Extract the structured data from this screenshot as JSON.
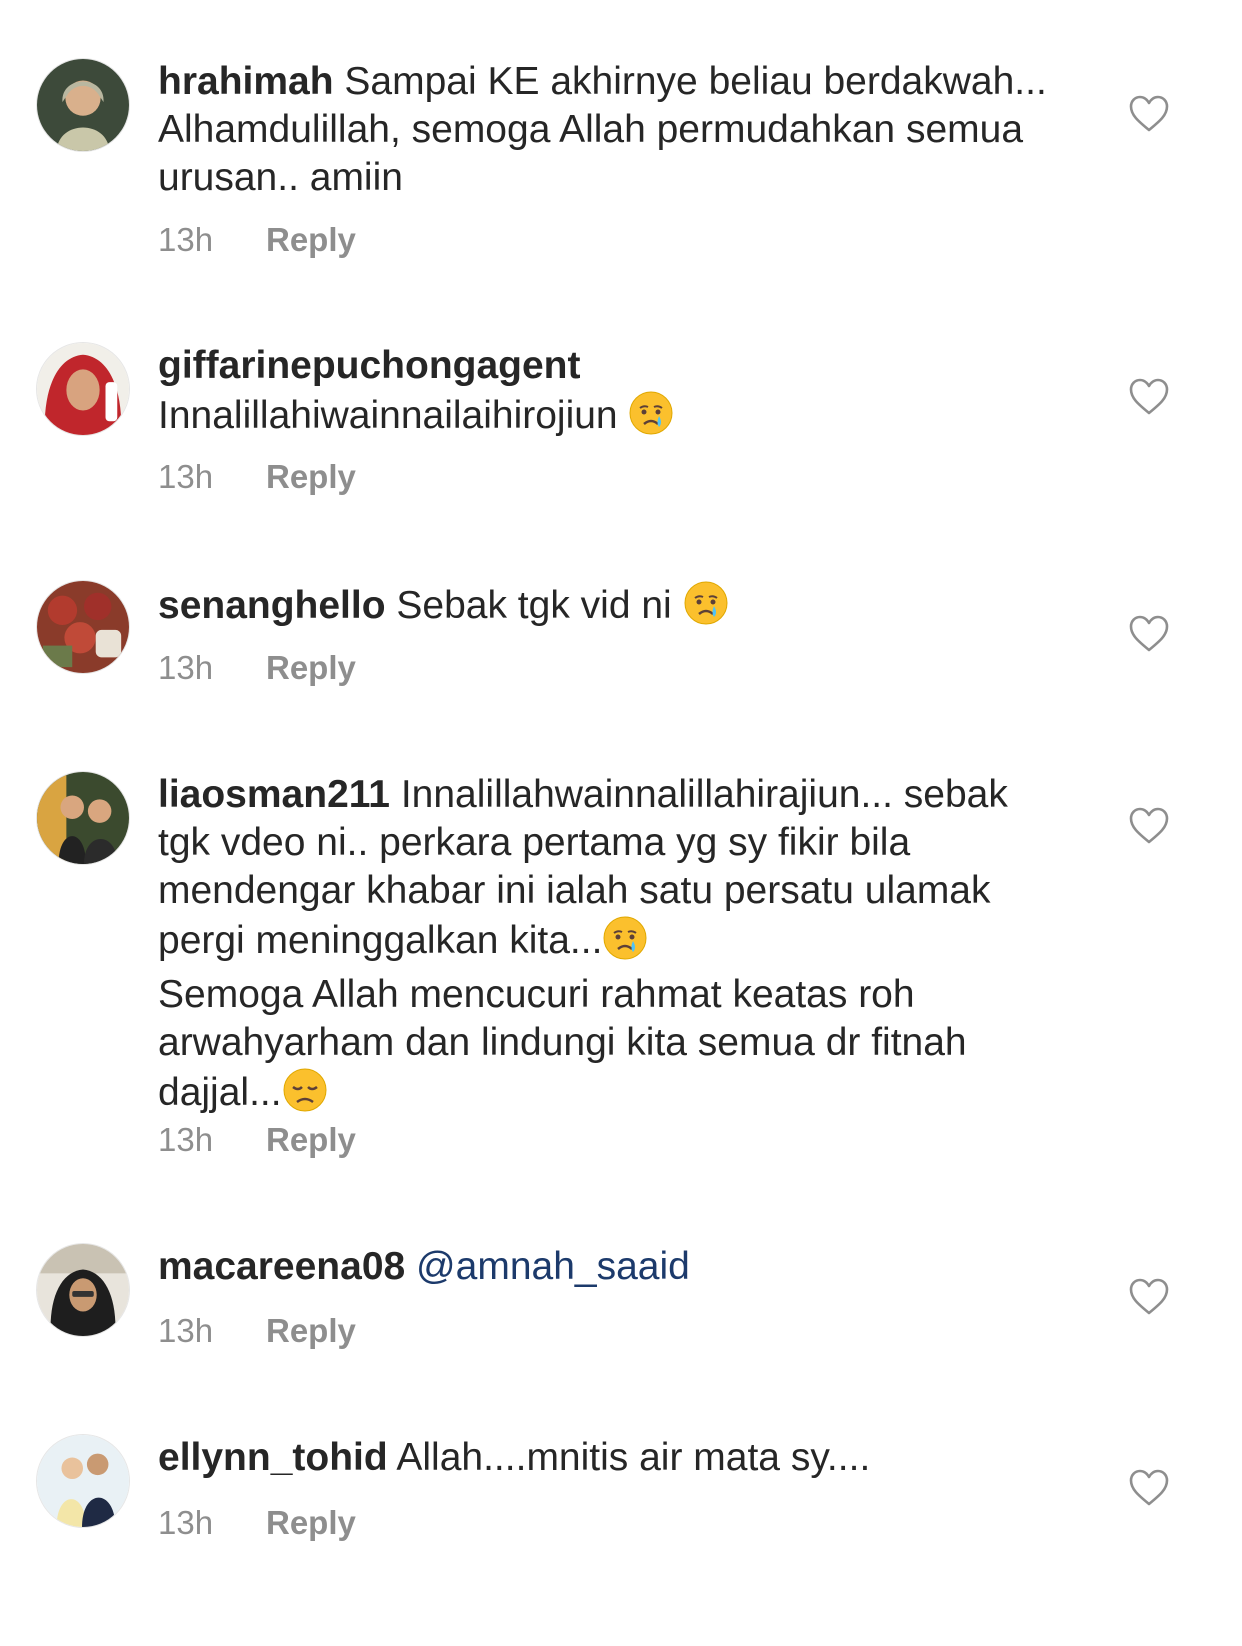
{
  "colors": {
    "username": "#262626",
    "text": "#262626",
    "meta": "#8e8e8e",
    "mention": "#1c3a6b"
  },
  "icons": {
    "like": "heart-outline-icon",
    "crying": "crying-face-emoji",
    "disappointed": "disappointed-face-emoji"
  },
  "reply_label": "Reply",
  "comments": [
    {
      "username": "hrahimah",
      "text": "Sampai KE akhirnye beliau berdakwah... Alhamdulillah, semoga Allah permudahkan semua urusan.. amiin",
      "time": "13h",
      "reply": "Reply"
    },
    {
      "username": "giffarinepuchongagent",
      "text": "Innalillahiwainnailaihirojiun",
      "emoji": "😢",
      "time": "13h",
      "reply": "Reply"
    },
    {
      "username": "senanghello",
      "text": "Sebak tgk vid ni",
      "emoji": "😢",
      "time": "13h",
      "reply": "Reply"
    },
    {
      "username": "liaosman211",
      "text": "Innalillahwainnalillahirajiun... sebak tgk vdeo ni.. perkara pertama yg sy fikir bila mendengar khabar ini ialah satu persatu ulamak pergi meninggalkan kita...",
      "emoji": "😢",
      "text2": "Semoga Allah mencucuri rahmat keatas roh arwahyarham dan lindungi kita semua dr fitnah dajjal...",
      "emoji2": "😞",
      "time": "13h",
      "reply": "Reply"
    },
    {
      "username": "macareena08",
      "mention": "@amnah_saaid",
      "time": "13h",
      "reply": "Reply"
    },
    {
      "username": "ellynn_tohid",
      "text": "Allah....mnitis air mata sy....",
      "time": "13h",
      "reply": "Reply"
    }
  ]
}
